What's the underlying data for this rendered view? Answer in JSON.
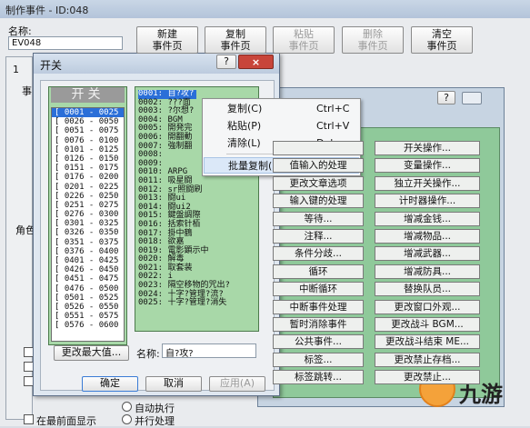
{
  "main": {
    "title": "制作事件 - ID:048",
    "name_label": "名称:",
    "name_value": "EV048",
    "buttons": [
      "新建\n事件页",
      "复制\n事件页",
      "粘贴\n事件页",
      "删除\n事件页",
      "清空\n事件页"
    ],
    "tab_label": "1",
    "left_labels": [
      "事",
      "角色"
    ],
    "bottom_checks": [
      "在最前面显示"
    ],
    "bottom_radios": [
      "自动执行",
      "并行处理"
    ]
  },
  "cmd_dialog": {
    "help": "?",
    "left_buttons": [
      " ",
      "值输入的处理",
      "更改文章选项",
      "输入键的处理",
      "等待...",
      "注释...",
      "条件分歧...",
      "循环",
      "中断循环",
      "中断事件处理",
      "暂时消除事件",
      "公共事件...",
      "标签...",
      "标签跳转..."
    ],
    "right_buttons": [
      "开关操作...",
      "变量操作...",
      "独立开关操作...",
      "计时器操作...",
      "增减金钱...",
      "增减物品...",
      "增减武器...",
      "增减防具...",
      "替换队员...",
      "更改窗口外观...",
      "更改战斗 BGM...",
      "更改战斗结束 ME...",
      "更改禁止存档...",
      "更改禁止..."
    ]
  },
  "switch_dialog": {
    "title": "开关",
    "help": "?",
    "close": "×",
    "header": "开关",
    "ranges": [
      "[ 0001 - 0025 ]",
      "[ 0026 - 0050 ]",
      "[ 0051 - 0075 ]",
      "[ 0076 - 0100 ]",
      "[ 0101 - 0125 ]",
      "[ 0126 - 0150 ]",
      "[ 0151 - 0175 ]",
      "[ 0176 - 0200 ]",
      "[ 0201 - 0225 ]",
      "[ 0226 - 0250 ]",
      "[ 0251 - 0275 ]",
      "[ 0276 - 0300 ]",
      "[ 0301 - 0325 ]",
      "[ 0326 - 0350 ]",
      "[ 0351 - 0375 ]",
      "[ 0376 - 0400 ]",
      "[ 0401 - 0425 ]",
      "[ 0426 - 0450 ]",
      "[ 0451 - 0475 ]",
      "[ 0476 - 0500 ]",
      "[ 0501 - 0525 ]",
      "[ 0526 - 0550 ]",
      "[ 0551 - 0575 ]",
      "[ 0576 - 0600 ]"
    ],
    "switches": [
      "0001: 自?攻?",
      "0002: ???面",
      "0003: ?尔想?",
      "0004: BGM",
      "0005: 開発完",
      "0006: 開翻動",
      "0007: 強制翻",
      "0008:",
      "0009:",
      "0010: ARPG",
      "0011: 吸星闘",
      "0012: sr照闘刷",
      "0013: 闘ui",
      "0014: 闘ui2",
      "0015: 鍵盤調際",
      "0016: 括索针栢",
      "0017: 掛中鶴",
      "0018: 欲嘉",
      "0019: 電影顕示中",
      "0020: 解毒",
      "0021: 取套装",
      "0022: i",
      "0023: 隔空移物的咒出?",
      "0024: 十字?管理?流?",
      "0025: 十字?管理?消失"
    ],
    "change_max_button": "更改最大值...",
    "name_label": "名称:",
    "name_value": "自?攻?",
    "ok": "确定",
    "cancel": "取消",
    "apply": "应用(A)"
  },
  "context_menu": {
    "items": [
      {
        "label": "复制(C)",
        "shortcut": "Ctrl+C"
      },
      {
        "label": "粘贴(P)",
        "shortcut": "Ctrl+V"
      },
      {
        "label": "清除(L)",
        "shortcut": "Del"
      },
      {
        "label": "批量复制(M)...",
        "shortcut": ""
      }
    ]
  },
  "watermark": {
    "text": "九游"
  }
}
